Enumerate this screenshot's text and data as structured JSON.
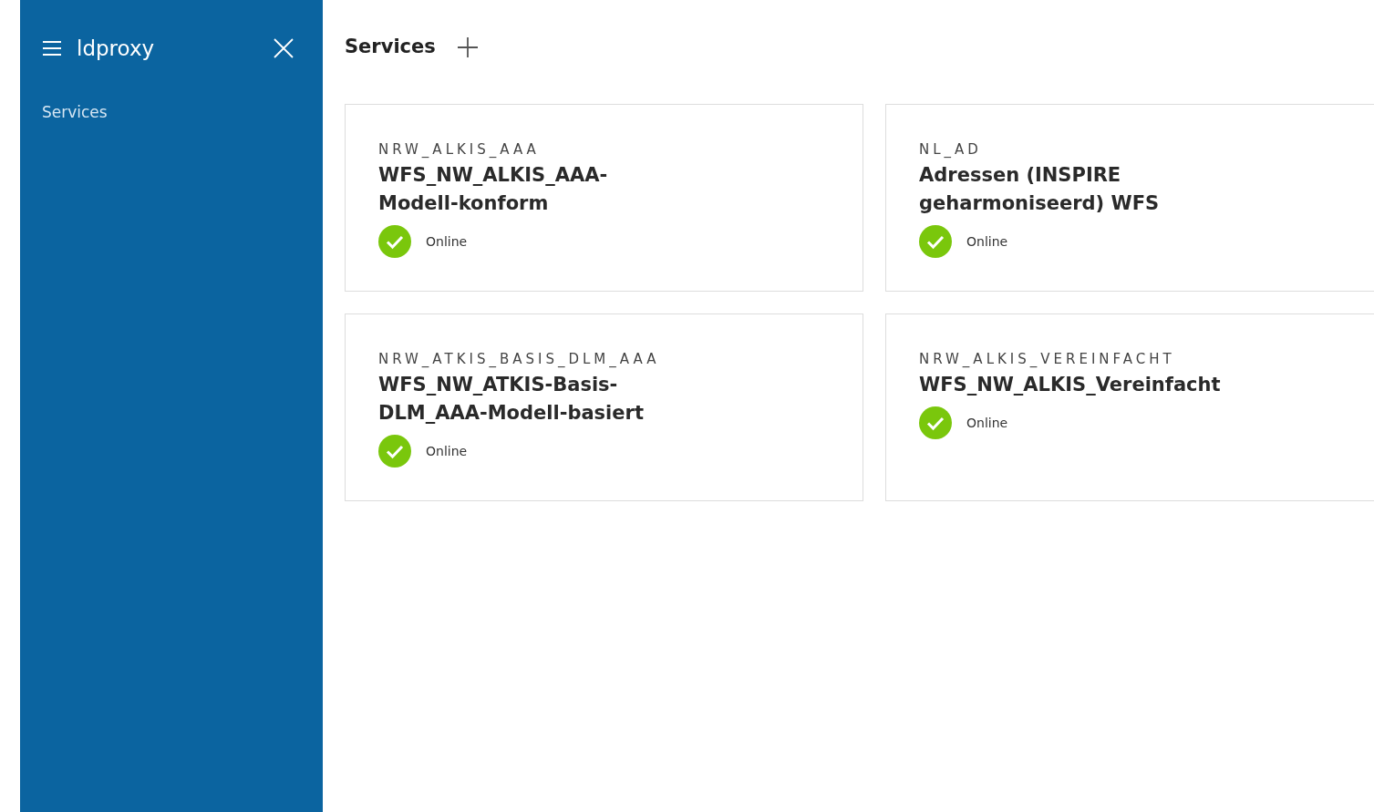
{
  "sidebar": {
    "title": "ldproxy",
    "items": [
      {
        "label": "Services",
        "selected": false
      }
    ]
  },
  "header": {
    "title": "Services"
  },
  "services": [
    {
      "id_label": "NRW_ALKIS_AAA",
      "name": "WFS_NW_ALKIS_AAA-Modell-konform",
      "online": true,
      "status_label": "Online"
    },
    {
      "id_label": "NL_AD",
      "name": "Adressen (INSPIRE geharmoniseerd) WFS",
      "online": true,
      "status_label": "Online"
    },
    {
      "id_label": "NRW_ATKIS_BASIS_DLM_AAA",
      "name": "WFS_NW_ATKIS-Basis-DLM_AAA-Modell-basiert",
      "online": true,
      "status_label": "Online"
    },
    {
      "id_label": "NRW_ALKIS_VEREINFACHT",
      "name": "WFS_NW_ALKIS_Vereinfacht",
      "online": true,
      "status_label": "Online"
    }
  ]
}
